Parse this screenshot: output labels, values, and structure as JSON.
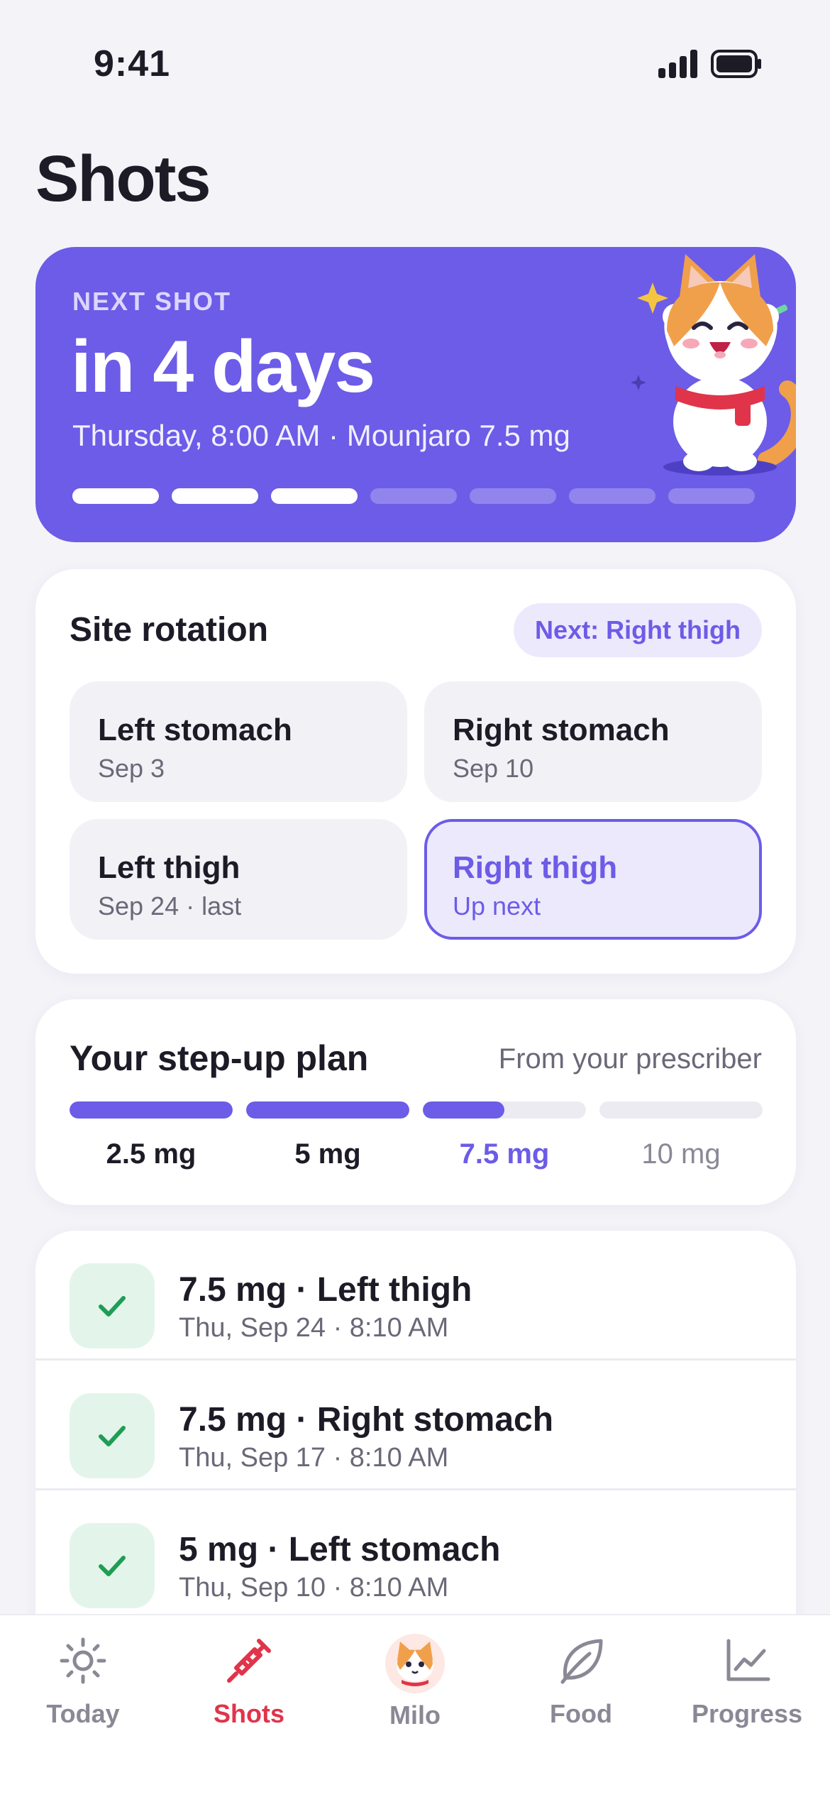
{
  "status_bar": {
    "time": "9:41"
  },
  "page": {
    "title": "Shots"
  },
  "next_shot": {
    "eyebrow": "NEXT SHOT",
    "headline": "in 4 days",
    "detail": "Thursday, 8:00 AM · Mounjaro 7.5 mg",
    "doses_completed": 3,
    "doses_total": 7,
    "accent_color": "#6c5ce7"
  },
  "rotation": {
    "title": "Site rotation",
    "next_pill": "Next: Right thigh",
    "sites": [
      {
        "name": "Left stomach",
        "date": "Sep 3"
      },
      {
        "name": "Right stomach",
        "date": "Sep 10"
      },
      {
        "name": "Left thigh",
        "date": "Sep 24 · last"
      },
      {
        "name": "Right thigh",
        "date": "Up next"
      }
    ]
  },
  "plan": {
    "title": "Your step-up plan",
    "note": "From your prescriber",
    "steps": [
      {
        "label": "2.5 mg",
        "progress": 1.0
      },
      {
        "label": "5 mg",
        "progress": 1.0
      },
      {
        "label": "7.5 mg",
        "progress": 0.5
      },
      {
        "label": "10 mg",
        "progress": 0.0
      }
    ]
  },
  "history": [
    {
      "title": "7.5 mg · Left thigh",
      "sub": "Thu, Sep 24 · 8:10 AM"
    },
    {
      "title": "7.5 mg · Right stomach",
      "sub": "Thu, Sep 17 · 8:10 AM"
    },
    {
      "title": "5 mg · Left stomach",
      "sub": "Thu, Sep 10 · 8:10 AM"
    }
  ],
  "tabs": [
    {
      "label": "Today",
      "icon": "sun-icon"
    },
    {
      "label": "Shots",
      "icon": "syringe-icon"
    },
    {
      "label": "Milo",
      "icon": "cat-avatar-icon"
    },
    {
      "label": "Food",
      "icon": "leaf-icon"
    },
    {
      "label": "Progress",
      "icon": "chart-icon"
    }
  ],
  "colors": {
    "accent": "#6c5ce7",
    "active_tab": "#e0344a",
    "success": "#1f9d55"
  }
}
